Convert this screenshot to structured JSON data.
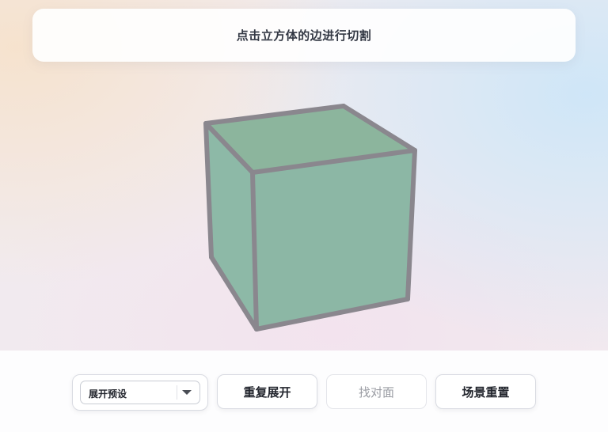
{
  "header": {
    "instruction": "点击立方体的边进行切割"
  },
  "cube": {
    "face_color": "#8cb7a5",
    "edge_color": "#8a878e"
  },
  "controls": {
    "preset_select": {
      "value": "展开预设"
    },
    "repeat_unfold_label": "重复展开",
    "find_opposite_label": "找对面",
    "reset_scene_label": "场景重置"
  }
}
